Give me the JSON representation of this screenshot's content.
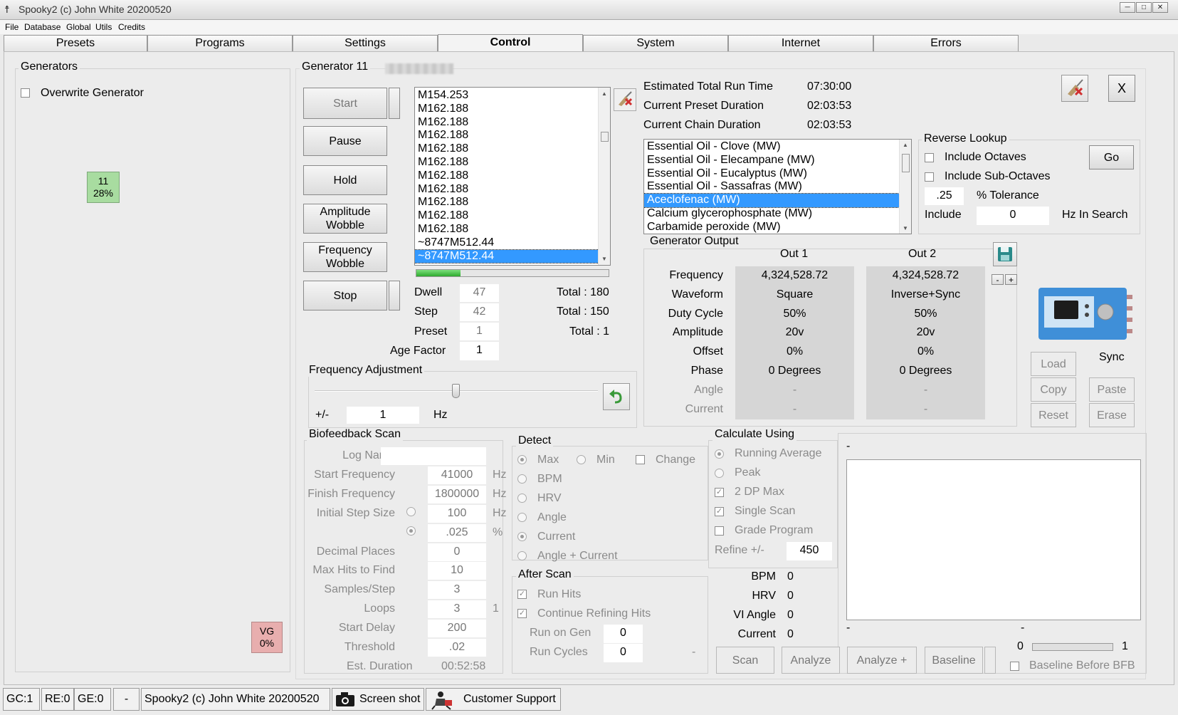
{
  "window": {
    "title": "Spooky2 (c) John White 20200520"
  },
  "menu": [
    "File",
    "Database",
    "Global",
    "Utils",
    "Credits"
  ],
  "tabs": [
    "Presets",
    "Programs",
    "Settings",
    "Control",
    "System",
    "Internet",
    "Errors"
  ],
  "generators": {
    "title": "Generators",
    "overwrite_label": "Overwrite Generator",
    "gen_tile": {
      "id": "11",
      "pct": "28%"
    },
    "vg_tile": {
      "id": "VG",
      "pct": "0%"
    }
  },
  "control": {
    "generator_label": "Generator 11",
    "buttons": {
      "start": "Start",
      "pause": "Pause",
      "hold": "Hold",
      "amp_wobble": "Amplitude Wobble",
      "freq_wobble": "Frequency Wobble",
      "stop": "Stop"
    },
    "freq_list": [
      "M154.253",
      "M162.188",
      "M162.188",
      "M162.188",
      "M162.188",
      "M162.188",
      "M162.188",
      "M162.188",
      "M162.188",
      "M162.188",
      "M162.188",
      "~8747M512.44",
      "~8747M512.44"
    ],
    "freq_list_selected": 12,
    "progress": 0.23,
    "dwell": {
      "label": "Dwell",
      "value": "47",
      "total": "Total : 180"
    },
    "step": {
      "label": "Step",
      "value": "42",
      "total": "Total : 150"
    },
    "preset": {
      "label": "Preset",
      "value": "1",
      "total": "Total : 1"
    },
    "age_factor": {
      "label": "Age Factor",
      "value": "1"
    }
  },
  "run_times": {
    "estimated_total_label": "Estimated Total Run Time",
    "estimated_total": "07:30:00",
    "preset_duration_label": "Current Preset Duration",
    "preset_duration": "02:03:53",
    "chain_duration_label": "Current Chain Duration",
    "chain_duration": "02:03:53"
  },
  "program_list": {
    "items": [
      "Essential Oil - Clove (MW)",
      "Essential Oil - Elecampane (MW)",
      "Essential Oil - Eucalyptus (MW)",
      "Essential Oil - Sassafras (MW)",
      "Aceclofenac (MW)",
      "Calcium glycerophosphate (MW)",
      "Carbamide peroxide (MW)"
    ],
    "selected": 4
  },
  "close_button": "X",
  "reverse_lookup": {
    "title": "Reverse Lookup",
    "include_octaves": "Include Octaves",
    "include_sub_octaves": "Include Sub-Octaves",
    "go": "Go",
    "tolerance_value": ".25",
    "tolerance_label": "% Tolerance",
    "include_label": "Include",
    "include_value": "0",
    "hz_in_search": "Hz In Search"
  },
  "freq_adjust": {
    "title": "Frequency Adjustment",
    "slider_position": 0.5,
    "pm_label": "+/-",
    "value": "1",
    "unit": "Hz"
  },
  "gen_output": {
    "title": "Generator Output",
    "col1": "Out 1",
    "col2": "Out 2",
    "rows": [
      {
        "label": "Frequency",
        "out1": "4,324,528.72",
        "out2": "4,324,528.72",
        "dim": false
      },
      {
        "label": "Waveform",
        "out1": "Square",
        "out2": "Inverse+Sync",
        "dim": false
      },
      {
        "label": "Duty Cycle",
        "out1": "50%",
        "out2": "50%",
        "dim": false
      },
      {
        "label": "Amplitude",
        "out1": "20v",
        "out2": "20v",
        "dim": false
      },
      {
        "label": "Offset",
        "out1": "0%",
        "out2": "0%",
        "dim": false
      },
      {
        "label": "Phase",
        "out1": "0 Degrees",
        "out2": "0 Degrees",
        "dim": false
      },
      {
        "label": "Angle",
        "out1": "-",
        "out2": "-",
        "dim": true
      },
      {
        "label": "Current",
        "out1": "-",
        "out2": "-",
        "dim": true
      }
    ],
    "minus": "-",
    "plus": "+"
  },
  "sync_panel": {
    "load": "Load",
    "sync": "Sync",
    "copy": "Copy",
    "paste": "Paste",
    "reset": "Reset",
    "erase": "Erase"
  },
  "biofeedback": {
    "title": "Biofeedback Scan",
    "rows": [
      {
        "label": "Log Name",
        "value": "",
        "unit": ""
      },
      {
        "label": "Start Frequency",
        "value": "41000",
        "unit": "Hz"
      },
      {
        "label": "Finish Frequency",
        "value": "1800000",
        "unit": "Hz"
      },
      {
        "label": "Initial Step Size",
        "value": "100",
        "unit": "Hz"
      },
      {
        "label": "",
        "value": ".025",
        "unit": "%"
      },
      {
        "label": "Decimal Places",
        "value": "0",
        "unit": ""
      },
      {
        "label": "Max Hits to Find",
        "value": "10",
        "unit": ""
      },
      {
        "label": "Samples/Step",
        "value": "3",
        "unit": ""
      },
      {
        "label": "Loops",
        "value": "3",
        "unit": "1"
      },
      {
        "label": "Start Delay",
        "value": "200",
        "unit": ""
      },
      {
        "label": "Threshold",
        "value": ".02",
        "unit": ""
      }
    ],
    "est_duration_label": "Est. Duration",
    "est_duration": "00:52:58"
  },
  "detect": {
    "title": "Detect",
    "max": "Max",
    "min": "Min",
    "change": "Change",
    "bpm": "BPM",
    "hrv": "HRV",
    "angle": "Angle",
    "current": "Current",
    "angle_current": "Angle + Current"
  },
  "after_scan": {
    "title": "After Scan",
    "run_hits": "Run Hits",
    "continue_refining": "Continue Refining Hits",
    "run_on_gen_label": "Run on Gen",
    "run_on_gen": "0",
    "run_cycles_label": "Run Cycles",
    "run_cycles": "0",
    "dash": "-"
  },
  "calculate": {
    "title": "Calculate Using",
    "running_average": "Running Average",
    "peak": "Peak",
    "dp_max": "2 DP Max",
    "single_scan": "Single Scan",
    "grade_program": "Grade Program",
    "refine_label": "Refine +/-",
    "refine_value": "450"
  },
  "readings": [
    {
      "label": "BPM",
      "value": "0"
    },
    {
      "label": "HRV",
      "value": "0"
    },
    {
      "label": "VI Angle",
      "value": "0"
    },
    {
      "label": "Current",
      "value": "0"
    }
  ],
  "graph": {
    "top_label": "-",
    "bottom_left": "-",
    "bottom_mid": "-"
  },
  "scan_buttons": {
    "scan": "Scan",
    "analyze": "Analyze",
    "analyze_plus": "Analyze +",
    "baseline": "Baseline"
  },
  "baseline_slider": {
    "min": "0",
    "max": "1"
  },
  "baseline_before_bfb": "Baseline Before BFB",
  "status": {
    "gc": "GC:1",
    "re": "RE:0",
    "ge": "GE:0",
    "dash": "-",
    "copyright": "Spooky2 (c) John White 20200520",
    "screenshot": "Screen shot",
    "support": "Customer Support"
  }
}
